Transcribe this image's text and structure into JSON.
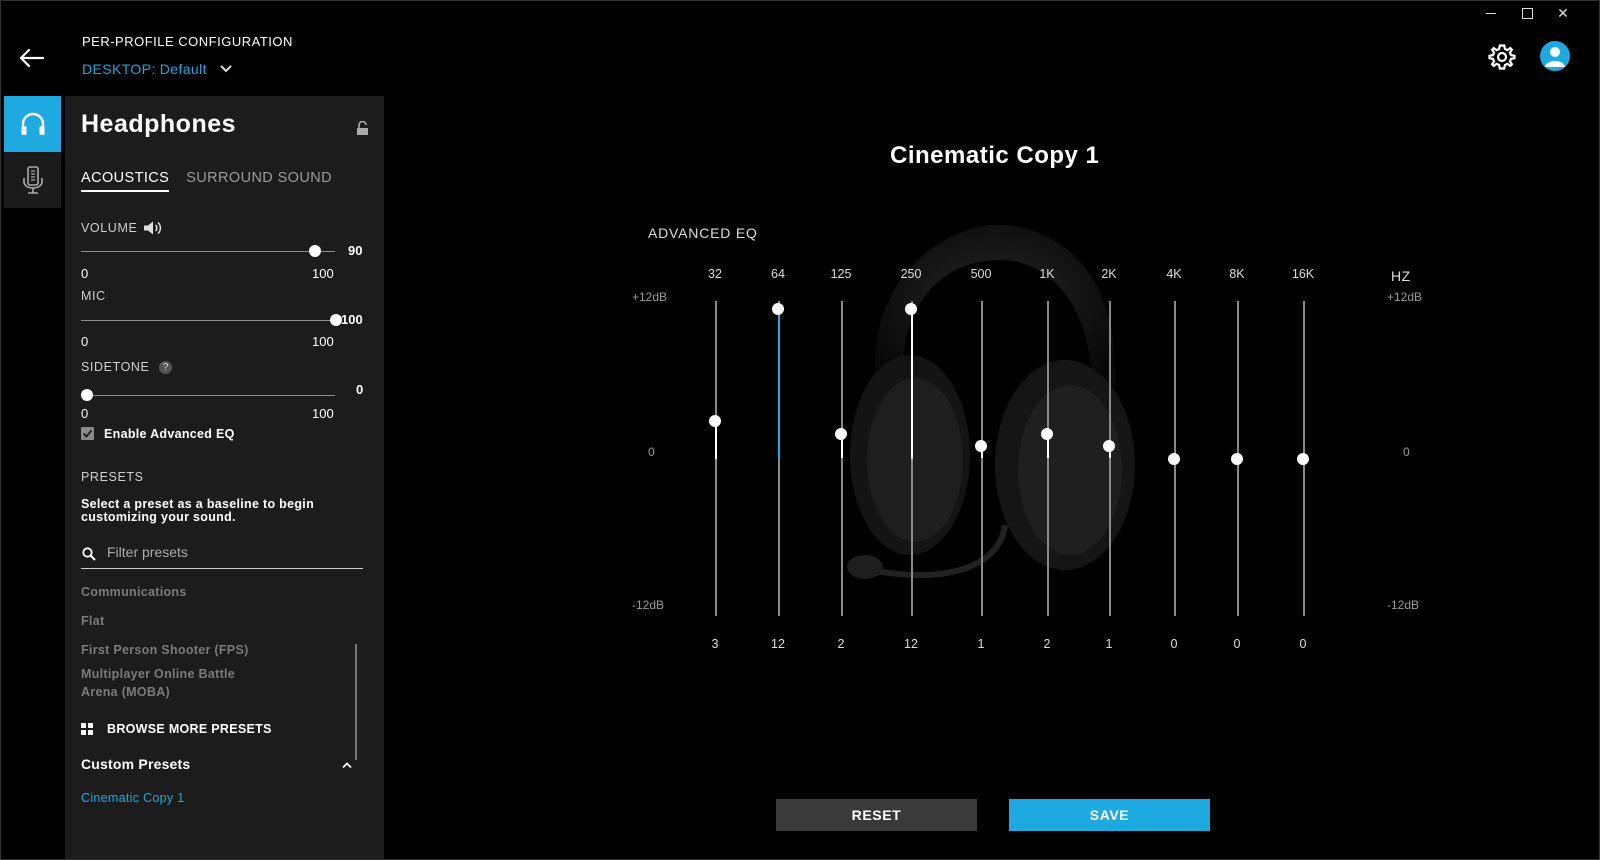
{
  "header": {
    "profile_label": "PER-PROFILE CONFIGURATION",
    "desktop_prefix": "DESKTOP:",
    "desktop_value": "Default"
  },
  "panel": {
    "title": "Headphones",
    "tabs": [
      {
        "label": "ACOUSTICS",
        "active": true
      },
      {
        "label": "SURROUND SOUND",
        "active": false
      }
    ],
    "volume": {
      "label": "VOLUME",
      "value": "90",
      "min": "0",
      "max": "100"
    },
    "mic": {
      "label": "MIC",
      "value": "100",
      "min": "0",
      "max": "100"
    },
    "sidetone": {
      "label": "SIDETONE",
      "help": "?",
      "value": "0",
      "min": "0",
      "max": "100"
    },
    "enable_eq": {
      "label": "Enable Advanced EQ",
      "checked": true
    },
    "presets": {
      "title": "PRESETS",
      "description": "Select a preset as a baseline to begin customizing your sound.",
      "filter_placeholder": "Filter presets",
      "items": [
        "Communications",
        "Flat",
        "First Person Shooter (FPS)",
        "Multiplayer Online Battle Arena (MOBA)"
      ],
      "browse_label": "BROWSE MORE PRESETS"
    },
    "custom_presets": {
      "title": "Custom Presets",
      "items": [
        "Cinematic Copy 1"
      ]
    }
  },
  "main": {
    "preset_name": "Cinematic Copy 1",
    "eq_title": "ADVANCED EQ",
    "db_top": "+12dB",
    "db_mid": "0",
    "db_bottom": "-12dB",
    "hz_label": "HZ",
    "bands": [
      {
        "freq": "32",
        "value": 3
      },
      {
        "freq": "64",
        "value": 12
      },
      {
        "freq": "125",
        "value": 2
      },
      {
        "freq": "250",
        "value": 12
      },
      {
        "freq": "500",
        "value": 1
      },
      {
        "freq": "1K",
        "value": 2
      },
      {
        "freq": "2K",
        "value": 1
      },
      {
        "freq": "4K",
        "value": 0
      },
      {
        "freq": "8K",
        "value": 0
      },
      {
        "freq": "16K",
        "value": 0
      }
    ],
    "reset_label": "RESET",
    "save_label": "SAVE"
  },
  "colors": {
    "accent": "#1fa9e1",
    "panel_bg": "#1c1c1c",
    "background": "#000000"
  }
}
